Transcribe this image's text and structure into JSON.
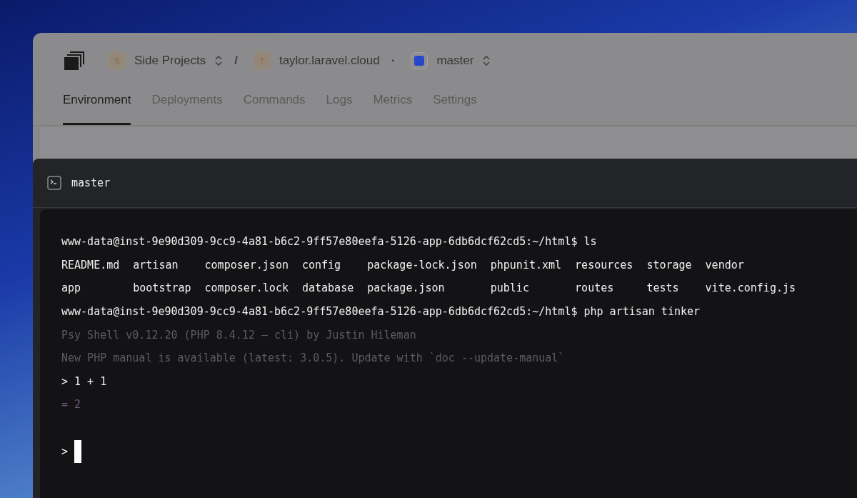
{
  "app": {
    "breadcrumbs": [
      {
        "kind": "project",
        "badge": "S",
        "label": "Side Projects",
        "separator": "/"
      },
      {
        "kind": "env",
        "badge": "T",
        "label": "taylor.laravel.cloud",
        "separator": "·"
      },
      {
        "kind": "branch",
        "color": "#2749c9",
        "label": "master"
      }
    ],
    "tabs": [
      {
        "label": "Environment",
        "selected": true
      },
      {
        "label": "Deployments",
        "selected": false
      },
      {
        "label": "Commands",
        "selected": false
      },
      {
        "label": "Logs",
        "selected": false
      },
      {
        "label": "Metrics",
        "selected": false
      },
      {
        "label": "Settings",
        "selected": false
      }
    ]
  },
  "terminal": {
    "title": "master",
    "lines": [
      {
        "kind": "command",
        "text": "www-data@inst-9e90d309-9cc9-4a81-b6c2-9ff57e80eefa-5126-app-6db6dcf62cd5:~/html$ ls"
      },
      {
        "kind": "grid",
        "rows": [
          [
            "README.md",
            "artisan",
            "composer.json",
            "config",
            "package-lock.json",
            "phpunit.xml",
            "resources",
            "storage",
            "vendor"
          ],
          [
            "app",
            "bootstrap",
            "composer.lock",
            "database",
            "package.json",
            "public",
            "routes",
            "tests",
            "vite.config.js"
          ]
        ]
      },
      {
        "kind": "command",
        "text": "www-data@inst-9e90d309-9cc9-4a81-b6c2-9ff57e80eefa-5126-app-6db6dcf62cd5:~/html$ php artisan tinker"
      },
      {
        "kind": "dim",
        "text": "Psy Shell v0.12.20 (PHP 8.4.12 — cli) by Justin Hileman"
      },
      {
        "kind": "dim",
        "text": "New PHP manual is available (latest: 3.0.5). Update with `doc --update-manual`"
      },
      {
        "kind": "command",
        "text": "> 1 + 1"
      },
      {
        "kind": "result",
        "text": "= 2"
      },
      {
        "kind": "blank"
      },
      {
        "kind": "prompt",
        "text": ">"
      }
    ]
  }
}
